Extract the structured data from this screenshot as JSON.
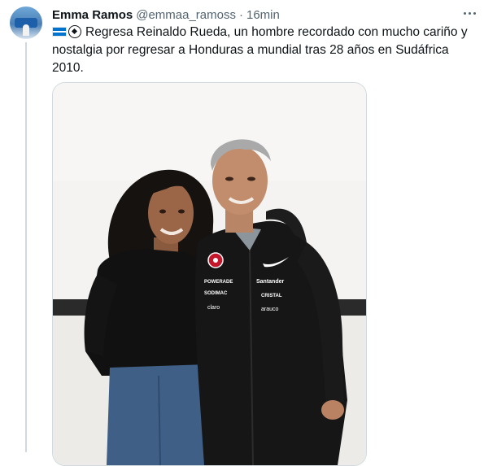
{
  "tweet": {
    "author_name": "Emma Ramos",
    "handle": "@emmaa_ramoss",
    "separator": "·",
    "time": "16min",
    "text": "Regresa Reinaldo Rueda, un hombre recordado con mucho cariño y nostalgia por regresar a Honduras a mundial tras 28 años en Sudáfrica 2010.",
    "emojis": [
      "honduras-flag",
      "soccer-ball"
    ]
  },
  "photo": {
    "jacket_logos": [
      "POWERADE",
      "SODIMAC",
      "claro",
      "Santander",
      "CRISTAL",
      "arauco"
    ]
  },
  "colors": {
    "text_primary": "#0f1419",
    "text_secondary": "#536471",
    "border": "#cfd9de"
  }
}
